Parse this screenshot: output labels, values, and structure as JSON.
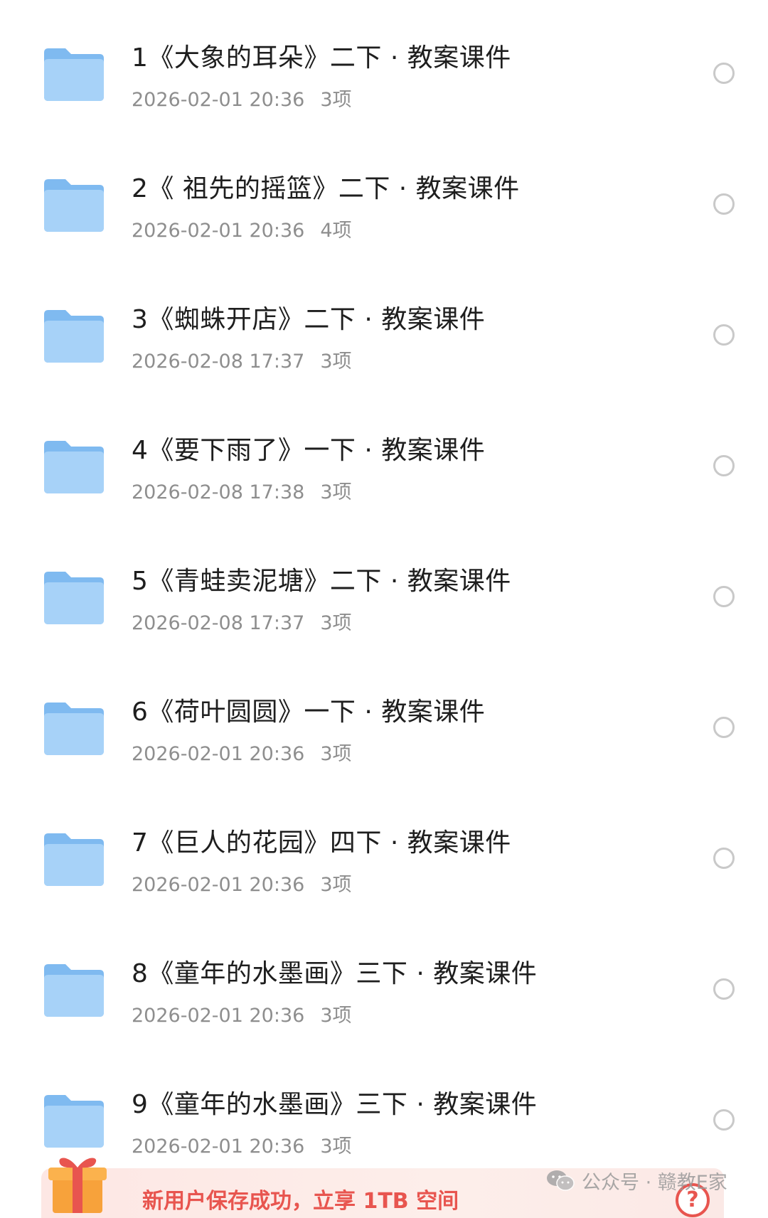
{
  "files": [
    {
      "title": "1《大象的耳朵》二下 · 教案课件",
      "date": "2026-02-01 20:36",
      "count": "3项"
    },
    {
      "title": "2《 祖先的摇篮》二下 · 教案课件",
      "date": "2026-02-01 20:36",
      "count": "4项"
    },
    {
      "title": "3《蜘蛛开店》二下 · 教案课件",
      "date": "2026-02-08 17:37",
      "count": "3项"
    },
    {
      "title": "4《要下雨了》一下 · 教案课件",
      "date": "2026-02-08 17:38",
      "count": "3项"
    },
    {
      "title": "5《青蛙卖泥塘》二下 · 教案课件",
      "date": "2026-02-08 17:37",
      "count": "3项"
    },
    {
      "title": "6《荷叶圆圆》一下 · 教案课件",
      "date": "2026-02-01 20:36",
      "count": "3项"
    },
    {
      "title": "7《巨人的花园》四下 · 教案课件",
      "date": "2026-02-01 20:36",
      "count": "3项"
    },
    {
      "title": "8《童年的水墨画》三下 · 教案课件",
      "date": "2026-02-01 20:36",
      "count": "3项"
    },
    {
      "title": "9《童年的水墨画》三下 · 教案课件",
      "date": "2026-02-01 20:36",
      "count": "3项"
    }
  ],
  "promo": {
    "text": "新用户保存成功，立享 1TB 空间",
    "help_glyph": "?"
  },
  "watermark": {
    "text": "公众号 · 赣教E家"
  },
  "icons": {
    "folder": "folder-icon",
    "radio": "select-radio",
    "gift": "gift-icon",
    "help": "help-icon",
    "wechat": "wechat-icon"
  },
  "colors": {
    "folder": "#8cc4f5",
    "title": "#1e1e1e",
    "meta": "#8e8e8e",
    "promo_accent": "#e8554f"
  }
}
